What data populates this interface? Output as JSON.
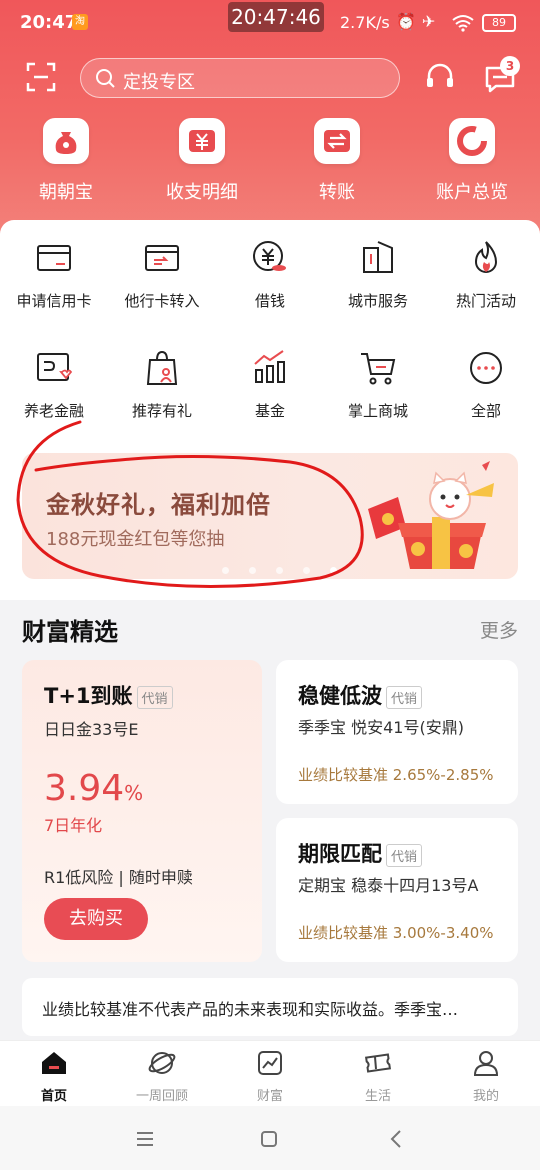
{
  "status_bar": {
    "time": "20:47",
    "badge": "淘",
    "clock": "20:47:46",
    "speed": "2.7K/s",
    "battery": "89"
  },
  "search": {
    "placeholder": "定投专区"
  },
  "messages": {
    "count": "3"
  },
  "quick_actions": [
    {
      "label": "朝朝宝",
      "icon": "money-bag-icon"
    },
    {
      "label": "收支明细",
      "icon": "yuan-icon"
    },
    {
      "label": "转账",
      "icon": "transfer-icon"
    },
    {
      "label": "账户总览",
      "icon": "pie-chart-icon"
    }
  ],
  "services": [
    {
      "label": "申请信用卡",
      "icon": "credit-card-icon"
    },
    {
      "label": "他行卡转入",
      "icon": "card-transfer-icon"
    },
    {
      "label": "借钱",
      "icon": "borrow-icon"
    },
    {
      "label": "城市服务",
      "icon": "city-icon"
    },
    {
      "label": "热门活动",
      "icon": "flame-icon"
    },
    {
      "label": "养老金融",
      "icon": "pension-icon"
    },
    {
      "label": "推荐有礼",
      "icon": "gift-bag-icon"
    },
    {
      "label": "基金",
      "icon": "fund-chart-icon"
    },
    {
      "label": "掌上商城",
      "icon": "cart-icon"
    },
    {
      "label": "全部",
      "icon": "more-icon"
    }
  ],
  "banner": {
    "title": "金秋好礼，福利加倍",
    "subtitle": "188元现金红包等您抽"
  },
  "wealth": {
    "title": "财富精选",
    "more": "更多",
    "featured": {
      "title": "T+1到账",
      "tag": "代销",
      "product": "日日金33号E",
      "rate": "3.94",
      "rate_unit": "%",
      "rate_label": "7日年化",
      "risk": "R1低风险 | 随时申赎",
      "button": "去购买"
    },
    "cards": [
      {
        "title": "稳健低波",
        "tag": "代销",
        "product": "季季宝  悦安41号(安鼎)",
        "perf": "业绩比较基准 2.65%-2.85%"
      },
      {
        "title": "期限匹配",
        "tag": "代销",
        "product": "定期宝  稳泰十四月13号A",
        "perf": "业绩比较基准 3.00%-3.40%"
      }
    ],
    "notice": "业绩比较基准不代表产品的未来表现和实际收益。季季宝…"
  },
  "tabs": [
    {
      "label": "首页",
      "icon": "home-icon"
    },
    {
      "label": "一周回顾",
      "icon": "planet-icon"
    },
    {
      "label": "财富",
      "icon": "wealth-chart-icon"
    },
    {
      "label": "生活",
      "icon": "ticket-icon"
    },
    {
      "label": "我的",
      "icon": "profile-icon"
    }
  ],
  "colors": {
    "brand": "#f0575a",
    "accent": "#e84c54",
    "perf": "#a7793d"
  }
}
